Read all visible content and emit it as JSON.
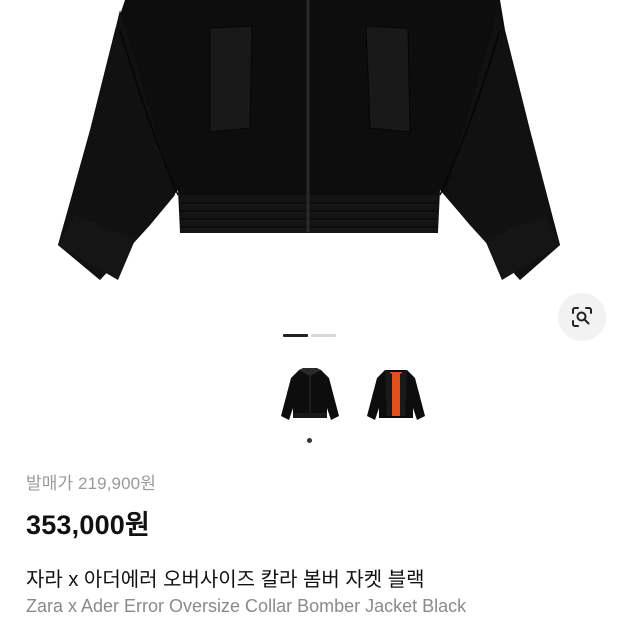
{
  "product": {
    "release_price": "발매가 219,900원",
    "price": "353,000원",
    "name_ko": "자라 x 아더에러 오버사이즈 칼라 봄버 자켓 블랙",
    "name_en": "Zara x Ader Error Oversize Collar Bomber Jacket Black"
  },
  "gallery": {
    "page_count": 2,
    "active_page": 1,
    "thumbnails": [
      {
        "name": "thumbnail-front",
        "selected": true
      },
      {
        "name": "thumbnail-open-lining",
        "selected": false
      }
    ]
  },
  "icons": {
    "lens": "image-search-icon"
  },
  "colors": {
    "jacket": "#0c0c0c",
    "lining": "#e0501e",
    "price_text": "#111111",
    "muted_text": "#9a9a9a"
  }
}
